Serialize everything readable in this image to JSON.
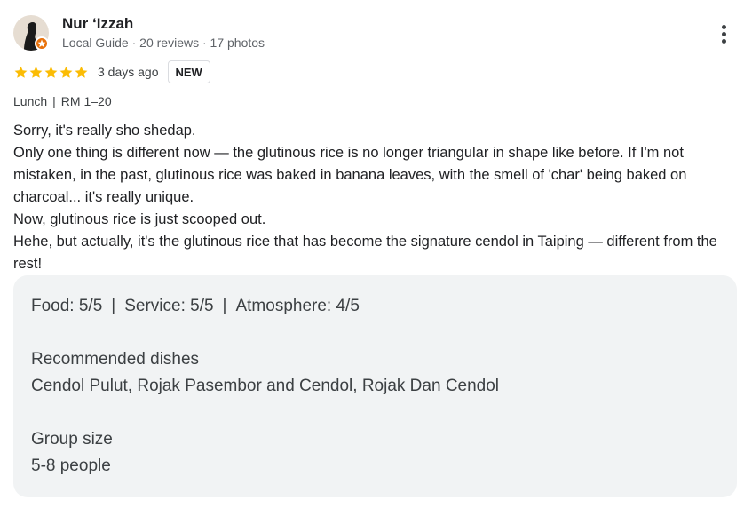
{
  "reviewer": {
    "name": "Nur ‘Izzah",
    "badge": "Local Guide",
    "reviews": "20 reviews",
    "photos": "17 photos",
    "meta_separator": " · "
  },
  "rating": {
    "stars": 5,
    "max_stars": 5,
    "star_color": "#fbbc04",
    "date": "3 days ago",
    "badge": "NEW"
  },
  "visit": {
    "meal": "Lunch",
    "separator": "|",
    "price": "RM 1–20"
  },
  "review_lines": [
    "Sorry, it's really sho shedap.",
    "Only one thing is different now — the glutinous rice is no longer triangular in shape like before. If I'm not mistaken, in the past, glutinous rice was baked in banana leaves, with the smell of 'char' being baked on charcoal... it's really unique.",
    "Now, glutinous rice is just scooped out.",
    "Hehe, but actually, it's the glutinous rice that has become the signature cendol in Taiping — different from the rest!"
  ],
  "details": {
    "food": "Food: 5/5",
    "service": "Service: 5/5",
    "atmosphere": "Atmosphere: 4/5",
    "separator": "|",
    "recommended_label": "Recommended dishes",
    "recommended_value": "Cendol Pulut, Rojak Pasembor and Cendol, Rojak Dan Cendol",
    "group_label": "Group size",
    "group_value": "5-8 people"
  },
  "icons": {
    "more": "more-vert-icon",
    "star": "star-icon",
    "badge": "local-guide-badge-icon"
  },
  "colors": {
    "guide_badge": "#e8710a",
    "card_background": "#f1f3f4"
  }
}
